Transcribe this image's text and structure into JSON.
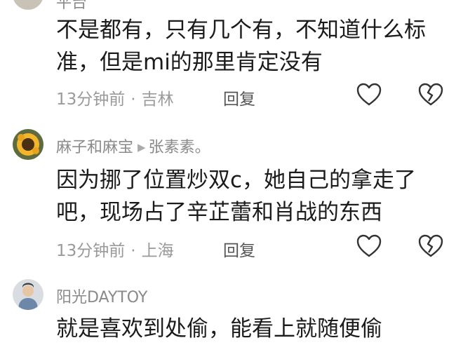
{
  "top_partial": {
    "username_fragment": "平台"
  },
  "comments": [
    {
      "lines": [
        "不是都有，只有几个有，不知道什么标",
        "准，但是mi的那里肯定没有"
      ],
      "time": "13分钟前",
      "location": "吉林",
      "reply_label": "回复"
    },
    {
      "username": "麻子和麻宝",
      "reply_to": "张素素。",
      "lines": [
        "因为挪了位置炒双c，她自己的拿走了",
        "吧，现场占了辛芷蕾和肖战的东西"
      ],
      "time": "13分钟前",
      "location": "上海",
      "reply_label": "回复"
    },
    {
      "username": "阳光DAYTOY",
      "lines": [
        "就是喜欢到处偷，能看上就随便偷"
      ]
    }
  ]
}
